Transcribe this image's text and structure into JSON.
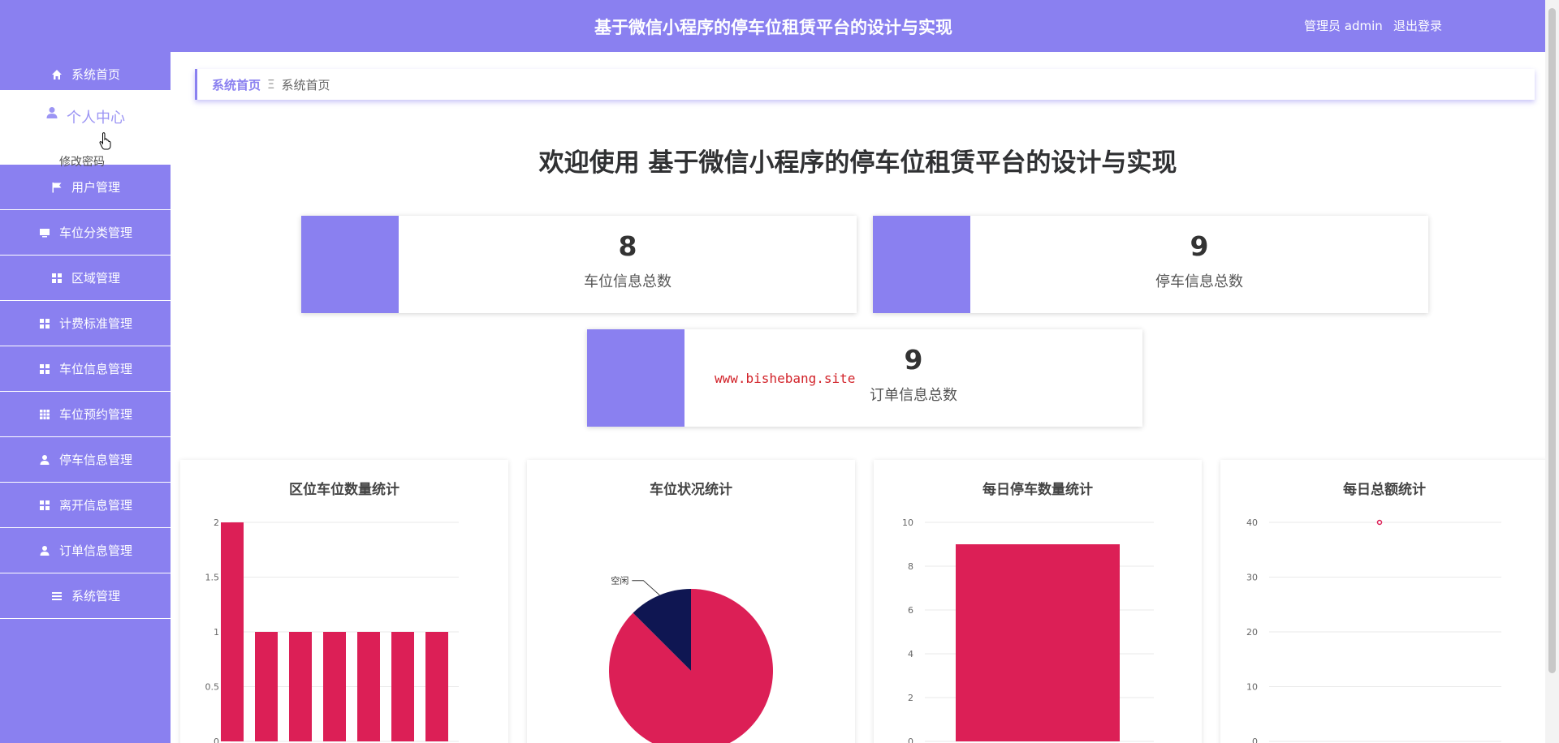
{
  "header": {
    "title": "基于微信小程序的停车位租赁平台的设计与实现",
    "user": "管理员 admin",
    "logout": "退出登录"
  },
  "sidebar": {
    "items": [
      {
        "label": "系统首页",
        "icon": "home-icon"
      },
      {
        "label": "个人中心",
        "icon": "user-icon"
      },
      {
        "label": "用户管理",
        "icon": "flag-icon"
      },
      {
        "label": "车位分类管理",
        "icon": "monitor-icon"
      },
      {
        "label": "区域管理",
        "icon": "grid-icon"
      },
      {
        "label": "计费标准管理",
        "icon": "grid-icon"
      },
      {
        "label": "车位信息管理",
        "icon": "grid-icon"
      },
      {
        "label": "车位预约管理",
        "icon": "table-icon"
      },
      {
        "label": "停车信息管理",
        "icon": "user-icon"
      },
      {
        "label": "离开信息管理",
        "icon": "grid-icon"
      },
      {
        "label": "订单信息管理",
        "icon": "user-icon"
      },
      {
        "label": "系统管理",
        "icon": "list-icon"
      }
    ],
    "submenu": "修改密码"
  },
  "breadcrumb": {
    "home": "系统首页",
    "separator": "Ξ",
    "current": "系统首页"
  },
  "welcome": "欢迎使用 基于微信小程序的停车位租赁平台的设计与实现",
  "stats": [
    {
      "value": "8",
      "label": "车位信息总数"
    },
    {
      "value": "9",
      "label": "停车信息总数"
    },
    {
      "value": "9",
      "label": "订单信息总数"
    }
  ],
  "watermark": "www.bishebang.site",
  "colors": {
    "accent": "#8a80f0",
    "bar": "#dc1f56",
    "pie_other": "#0f1652"
  },
  "chart_data": [
    {
      "type": "bar",
      "title": "区位车位数量统计",
      "categories": [
        "",
        "",
        "",
        "",
        "",
        "",
        ""
      ],
      "values": [
        2,
        1,
        1,
        1,
        1,
        1,
        1
      ],
      "yticks": [
        "0",
        "0.5",
        "1",
        "1.5",
        "2"
      ],
      "ylim": [
        0,
        2
      ],
      "grid": true
    },
    {
      "type": "pie",
      "title": "车位状况统计",
      "slices": [
        {
          "label": "",
          "value": 87.5
        },
        {
          "label": "空闲",
          "value": 12.5
        }
      ]
    },
    {
      "type": "bar",
      "title": "每日停车数量统计",
      "categories": [
        ""
      ],
      "values": [
        9
      ],
      "yticks": [
        "0",
        "2",
        "4",
        "6",
        "8",
        "10"
      ],
      "ylim": [
        0,
        10
      ],
      "grid": true
    },
    {
      "type": "line",
      "title": "每日总额统计",
      "x": [
        ""
      ],
      "values": [
        40
      ],
      "yticks": [
        "0",
        "10",
        "20",
        "30",
        "40"
      ],
      "ylim": [
        0,
        40
      ],
      "grid": true
    }
  ]
}
